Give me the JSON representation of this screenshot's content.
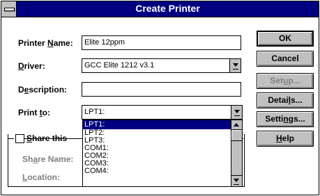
{
  "window": {
    "title": "Create Printer"
  },
  "fields": {
    "printer_name": {
      "label_pre": "Printer ",
      "label_u": "N",
      "label_post": "ame:",
      "value": "Elite 12ppm"
    },
    "driver": {
      "label_pre": "",
      "label_u": "D",
      "label_post": "river:",
      "value": "GCC Elite 1212 v3.1"
    },
    "description": {
      "label_pre": "D",
      "label_u": "e",
      "label_post": "scription:",
      "value": ""
    },
    "print_to": {
      "label_pre": "Print ",
      "label_u": "t",
      "label_post": "o:",
      "value": "LPT1:"
    }
  },
  "print_to_options": [
    "LPT1:",
    "LPT2:",
    "LPT3:",
    "COM1:",
    "COM2:",
    "COM3:",
    "COM4:"
  ],
  "print_to_selected": "LPT1:",
  "share": {
    "checkbox_pre": "",
    "checkbox_u": "S",
    "checkbox_post": "hare this",
    "checked": false,
    "share_name": {
      "label_pre": "Sh",
      "label_u": "a",
      "label_post": "re Name:"
    },
    "location": {
      "label_pre": "",
      "label_u": "L",
      "label_post": "ocation:"
    }
  },
  "buttons": {
    "ok": "OK",
    "cancel": "Cancel",
    "setup_pre": "Set",
    "setup_u": "u",
    "setup_post": "p...",
    "details_pre": "Detai",
    "details_u": "l",
    "details_post": "s...",
    "settings_pre": "Setti",
    "settings_u": "n",
    "settings_post": "gs...",
    "help_pre": "",
    "help_u": "H",
    "help_post": "elp"
  },
  "colors": {
    "title_bar": "#000080",
    "face": "#c0c0c0",
    "selection": "#000080",
    "disabled": "#808080"
  }
}
